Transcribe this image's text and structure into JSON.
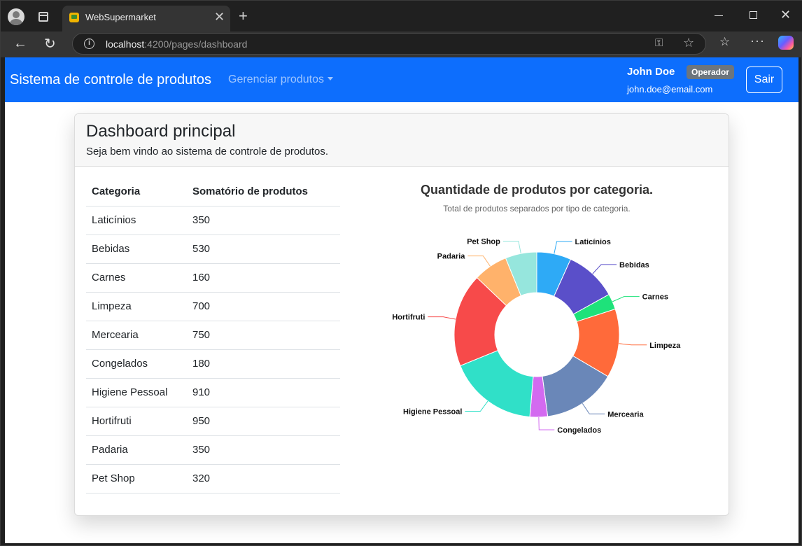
{
  "browser": {
    "tab_title": "WebSupermarket",
    "url_host": "localhost",
    "url_path": ":4200/pages/dashboard"
  },
  "navbar": {
    "brand": "Sistema de controle de produtos",
    "menu_label": "Gerenciar produtos",
    "user_name": "John Doe",
    "role_badge": "Operador",
    "user_email": "john.doe@email.com",
    "logout_label": "Sair"
  },
  "card": {
    "title": "Dashboard principal",
    "subtitle": "Seja bem vindo ao sistema de controle de produtos."
  },
  "table": {
    "headers": [
      "Categoria",
      "Somatório de produtos"
    ],
    "rows": [
      [
        "Laticínios",
        "350"
      ],
      [
        "Bebidas",
        "530"
      ],
      [
        "Carnes",
        "160"
      ],
      [
        "Limpeza",
        "700"
      ],
      [
        "Mercearia",
        "750"
      ],
      [
        "Congelados",
        "180"
      ],
      [
        "Higiene Pessoal",
        "910"
      ],
      [
        "Hortifruti",
        "950"
      ],
      [
        "Padaria",
        "350"
      ],
      [
        "Pet Shop",
        "320"
      ]
    ]
  },
  "chart_data": {
    "type": "pie",
    "title": "Quantidade de produtos por categoria.",
    "subtitle": "Total de produtos separados por tipo de categoria.",
    "categories": [
      "Laticínios",
      "Bebidas",
      "Carnes",
      "Limpeza",
      "Mercearia",
      "Congelados",
      "Higiene Pessoal",
      "Hortifruti",
      "Padaria",
      "Pet Shop"
    ],
    "values": [
      350,
      530,
      160,
      700,
      750,
      180,
      910,
      950,
      350,
      320
    ],
    "colors": [
      "#2eaaf6",
      "#5a4fc9",
      "#1ee27a",
      "#ff6a3a",
      "#6a87b8",
      "#d36af0",
      "#30e0c8",
      "#f74a4a",
      "#ffb26b",
      "#96e6dd"
    ],
    "donut": true
  }
}
